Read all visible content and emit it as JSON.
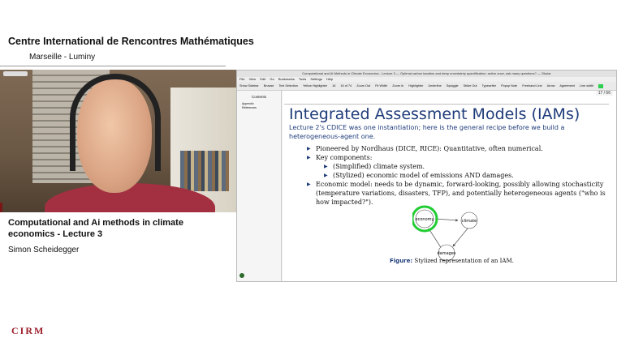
{
  "header": {
    "title": "Centre International de Rencontres Mathématiques",
    "subtitle": "Marseille - Luminy"
  },
  "lecture": {
    "title": "Computational and Ai methods in climate economics - Lecture 3",
    "lecturer": "Simon Scheidegger"
  },
  "logo": {
    "text": "CIRM"
  },
  "okular": {
    "window_title": "Computational and AI Methods in Climate Economics - Lecture 3 — Optimal carbon taxation and deep uncertainty quantification: active once, ask many questions? — Okular",
    "menu": [
      "File",
      "View",
      "Edit",
      "Go",
      "Bookmarks",
      "Tools",
      "Settings",
      "Help"
    ],
    "toolbar": {
      "show_sidebar": "Show Sidebar",
      "browse": "Browse",
      "text_selection": "Text Selection",
      "highlighter": "Yellow Highlighter",
      "page_current": "16",
      "page_of": "16 of 74",
      "zoom_fit": "Zoom Out",
      "fit_width": "Fit Width",
      "zoom_in": "Zoom In",
      "highlight": "Highlighter",
      "underline": "Underline",
      "squiggle": "Squiggle",
      "strike_out": "Strike Out",
      "typewriter": "Typewriter",
      "popup_note": "Popup Note",
      "freehand": "Freehand Line",
      "arrow": "Arrow",
      "agreement": "Agreement",
      "line_width": "Line width"
    },
    "sidebar": {
      "heading": "Contents",
      "items": [
        "Appendix",
        "References"
      ]
    },
    "page_counter": "17 / 66"
  },
  "slide": {
    "title": "Integrated Assessment Models (IAMs)",
    "intro": "Lecture 2's CDICE was one instantiation; here is the general recipe before we build a heterogeneous-agent one.",
    "bullet1": "Pioneered by Nordhaus (DICE, RICE): Quantitative, often numerical.",
    "bullet2": "Key components:",
    "sub1": "(Simplified) climate system.",
    "sub2": "(Stylized) economic model of emissions AND damages.",
    "bullet3": "Economic model: needs to be dynamic, forward-looking, possibly allowing stochasticity (temperature variations, disasters, TFP), and potentially heterogeneous agents (\"who is how impacted?\").",
    "diagram": {
      "node_economy": "economy",
      "node_climate": "climate",
      "node_damages": "damages",
      "highlight_color": "#22cc33"
    },
    "caption_label": "Figure:",
    "caption_text": "Stylized representation of an IAM."
  }
}
